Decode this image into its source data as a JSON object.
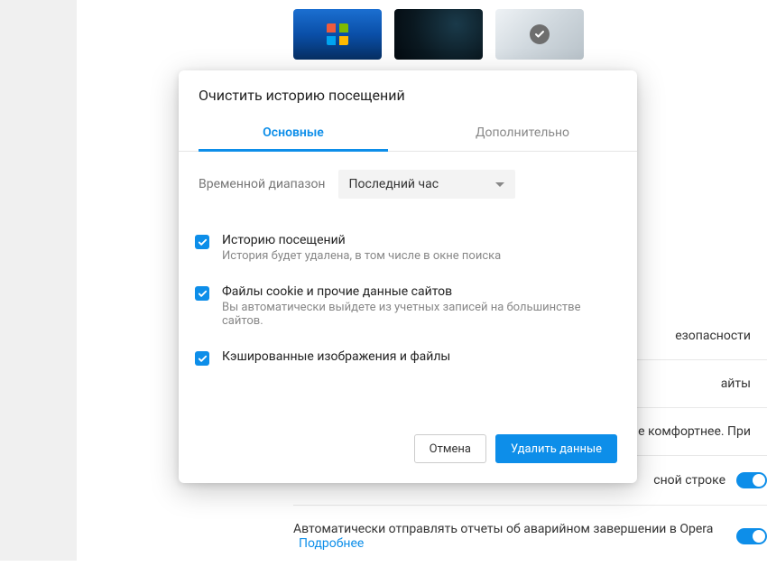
{
  "background": {
    "wallpapers": [
      "windows",
      "dark",
      "light-selected"
    ],
    "rows": {
      "security": "езопасности",
      "sites": "айты",
      "comfort": "е комфортнее. При",
      "address_line": "сной строке",
      "crash_reports_label": "Автоматически отправлять отчеты об аварийном завершении в Opera",
      "crash_reports_link": "Подробнее"
    }
  },
  "dialog": {
    "title": "Очистить историю посещений",
    "tabs": {
      "basic": "Основные",
      "advanced": "Дополнительно"
    },
    "range": {
      "label": "Временной диапазон",
      "value": "Последний час"
    },
    "options": [
      {
        "title": "Историю посещений",
        "desc": "История будет удалена, в том числе в окне поиска"
      },
      {
        "title": "Файлы cookie и прочие данные сайтов",
        "desc": "Вы автоматически выйдете из учетных записей на большинстве сайтов."
      },
      {
        "title": "Кэшированные изображения и файлы",
        "desc": ""
      }
    ],
    "buttons": {
      "cancel": "Отмена",
      "confirm": "Удалить данные"
    }
  }
}
